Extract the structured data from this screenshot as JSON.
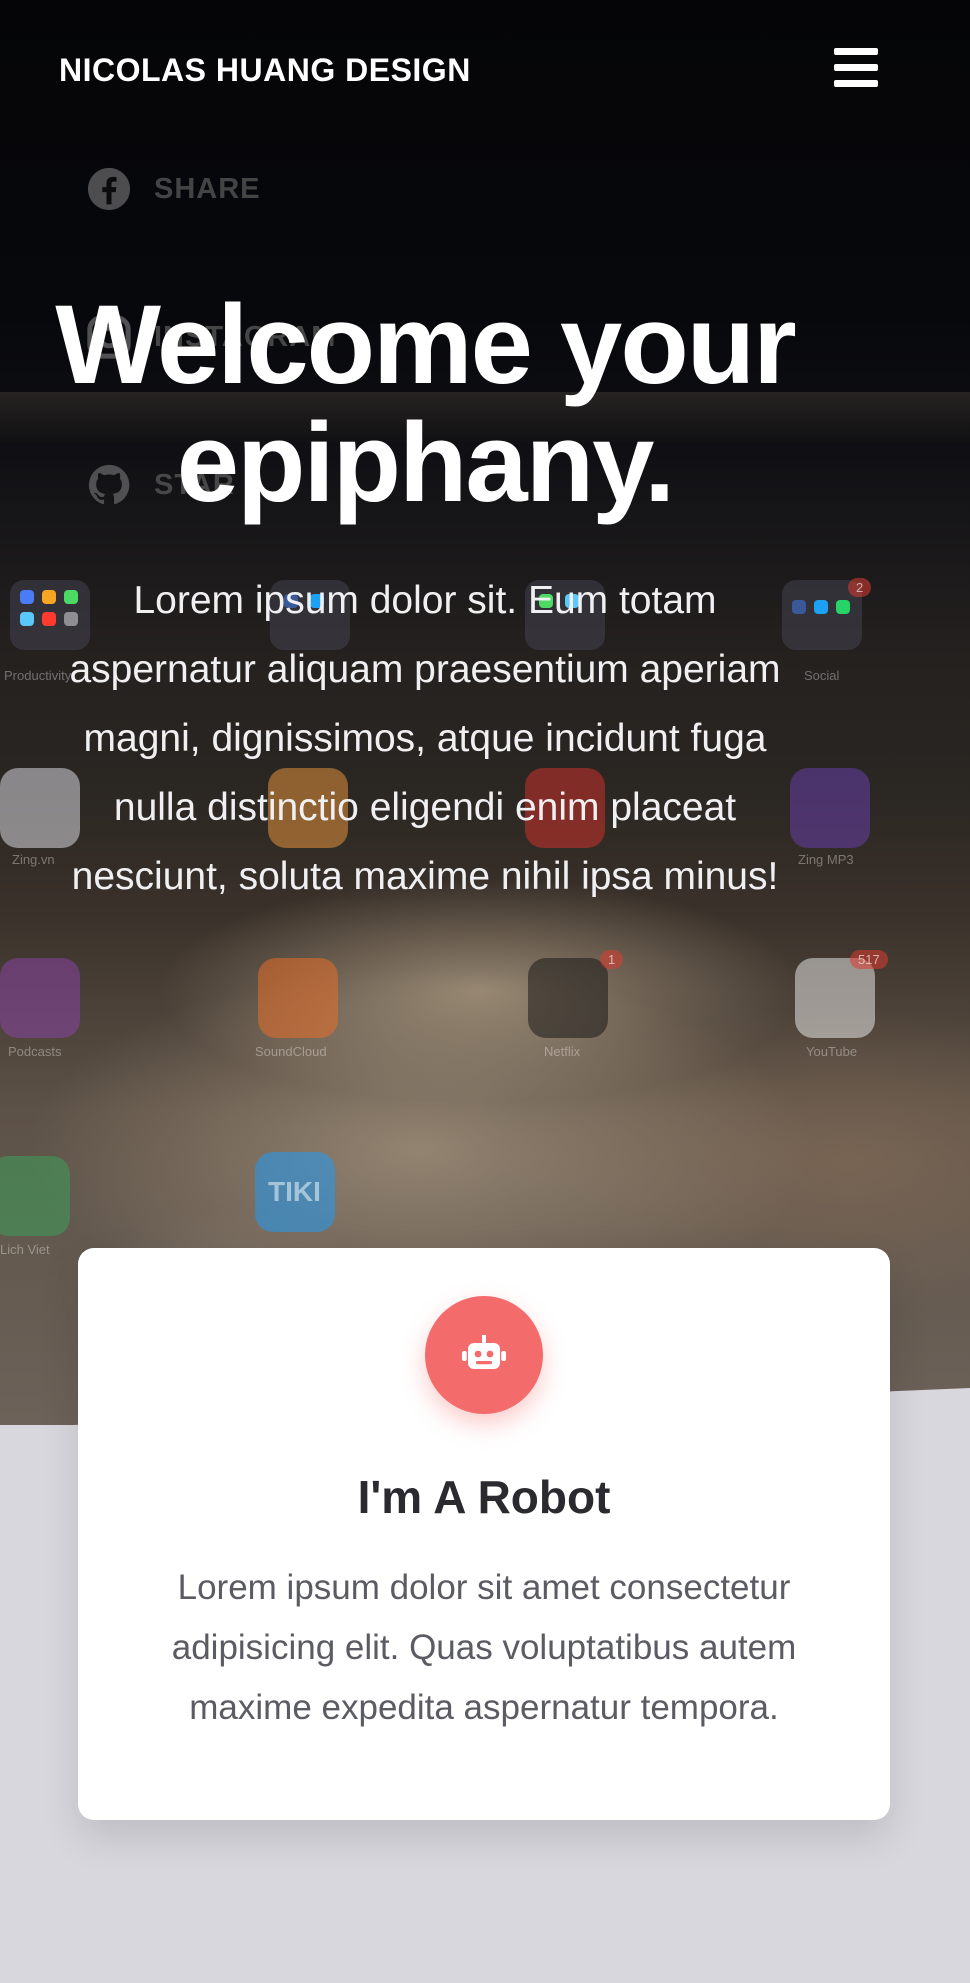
{
  "nav": {
    "brand": "NICOLAS HUANG DESIGN",
    "menu_icon": "hamburger-menu-icon"
  },
  "social": [
    {
      "label": "SHARE",
      "icon": "facebook-icon"
    },
    {
      "label": "INSTAGRAM",
      "icon": "instagram-icon"
    },
    {
      "label": "STAR",
      "icon": "github-icon"
    }
  ],
  "hero": {
    "headline_line1": "Welcome your",
    "headline_line2": "epiphany.",
    "lead": "Lorem ipsum dolor sit. Eum totam aspernatur aliquam praesentium aperiam magni, dignissimos, atque incidunt fuga nulla distinctio eligendi enim placeat nesciunt, soluta maxime nihil ipsa minus!"
  },
  "background_apps": {
    "labels": [
      "Productivity",
      "Social",
      "Zing.vn",
      "Zing MP3",
      "Podcasts",
      "SoundCloud",
      "Netflix",
      "YouTube",
      "Lich Viet"
    ],
    "badges": {
      "social": "2",
      "netflix": "1",
      "youtube": "517"
    },
    "tiki": "TIKI"
  },
  "card": {
    "icon": "robot-icon",
    "title": "I'm A Robot",
    "text": "Lorem ipsum dolor sit amet consectetur adipisicing elit. Quas voluptatibus autem maxime expedita aspernatur tempora."
  },
  "colors": {
    "accent": "#f36b6b",
    "page_bg": "#d8d7de",
    "card_bg": "#ffffff",
    "nav_text": "#ffffff"
  }
}
